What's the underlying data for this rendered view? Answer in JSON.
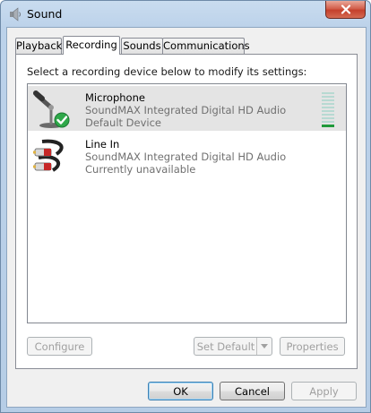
{
  "window": {
    "title": "Sound",
    "close_glyph": "✕"
  },
  "tabs": [
    {
      "label": "Playback",
      "active": false
    },
    {
      "label": "Recording",
      "active": true
    },
    {
      "label": "Sounds",
      "active": false
    },
    {
      "label": "Communications",
      "active": false
    }
  ],
  "panel": {
    "prompt": "Select a recording device below to modify its settings:",
    "devices": [
      {
        "name": "Microphone",
        "driver": "SoundMAX Integrated Digital HD Audio",
        "status": "Default Device",
        "icon": "microphone-icon",
        "selected": true,
        "meter_level": 0.1
      },
      {
        "name": "Line In",
        "driver": "SoundMAX Integrated Digital HD Audio",
        "status": "Currently unavailable",
        "icon": "line-in-cable-icon",
        "selected": false
      }
    ],
    "buttons": {
      "configure": "Configure",
      "set_default": "Set Default",
      "properties": "Properties"
    }
  },
  "footer": {
    "ok": "OK",
    "cancel": "Cancel",
    "apply": "Apply"
  },
  "colors": {
    "meter_active": "#1f9a3b",
    "meter_idle": "#b7d9d2",
    "close_button": "#c4402c"
  }
}
